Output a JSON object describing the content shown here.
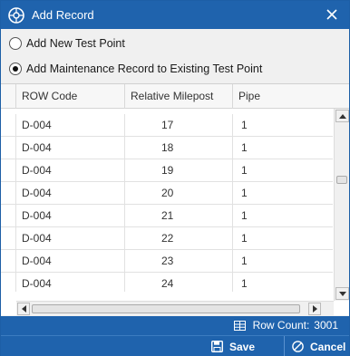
{
  "window": {
    "title": "Add Record"
  },
  "options": {
    "new_label": "Add New Test Point",
    "existing_label": "Add Maintenance Record to Existing Test Point",
    "selected": "existing"
  },
  "grid": {
    "columns": [
      "ROW Code",
      "Relative Milepost",
      "Pipe"
    ],
    "rows": [
      [
        "D-004",
        "17",
        "1"
      ],
      [
        "D-004",
        "18",
        "1"
      ],
      [
        "D-004",
        "19",
        "1"
      ],
      [
        "D-004",
        "20",
        "1"
      ],
      [
        "D-004",
        "21",
        "1"
      ],
      [
        "D-004",
        "22",
        "1"
      ],
      [
        "D-004",
        "23",
        "1"
      ],
      [
        "D-004",
        "24",
        "1"
      ]
    ]
  },
  "status": {
    "row_count_label": "Row Count:",
    "row_count": "3001"
  },
  "footer": {
    "save_label": "Save",
    "cancel_label": "Cancel"
  },
  "colors": {
    "accent": "#1f63ad",
    "grid_line": "#e1e1e1"
  },
  "icons": [
    "app-logo-icon",
    "close-icon",
    "table-icon",
    "save-icon",
    "cancel-icon",
    "arrow-up-icon",
    "arrow-down-icon",
    "arrow-left-icon",
    "arrow-right-icon"
  ]
}
